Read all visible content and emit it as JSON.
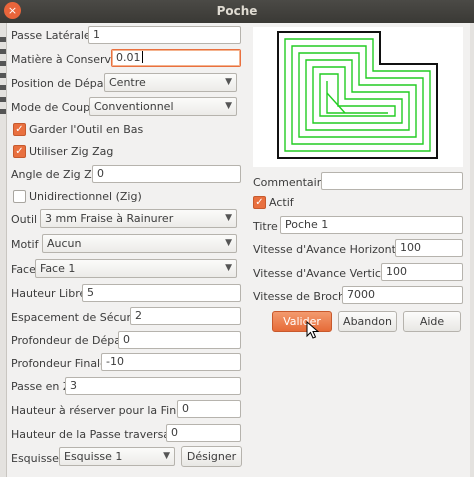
{
  "window": {
    "title": "Poche",
    "close_glyph": "×"
  },
  "form": {
    "passe_laterale": {
      "label": "Passe Latérale",
      "value": "1"
    },
    "matiere_a_conserver": {
      "label": "Matière à Conserver",
      "value": "0.01"
    },
    "position_depart": {
      "label": "Position de Départ",
      "value": "Centre"
    },
    "mode_coupe": {
      "label": "Mode de Coupe",
      "value": "Conventionnel"
    },
    "garder_outil_bas": {
      "label": "Garder l'Outil en Bas",
      "checked": true
    },
    "utiliser_zig_zag": {
      "label": "Utiliser Zig Zag",
      "checked": true
    },
    "angle_zig_zag": {
      "label": "Angle de Zig Zag",
      "value": "0"
    },
    "unidirectionnel": {
      "label": "Unidirectionnel (Zig)",
      "checked": false
    },
    "outil": {
      "label": "Outil",
      "value": "3 mm Fraise à Rainurer"
    },
    "motif": {
      "label": "Motif",
      "value": "Aucun"
    },
    "face": {
      "label": "Face",
      "value": "Face 1"
    },
    "hauteur_libre": {
      "label": "Hauteur Libre",
      "value": "5"
    },
    "espacement_securite": {
      "label": "Espacement de Sécurité",
      "value": "2"
    },
    "profondeur_depart": {
      "label": "Profondeur de Départ",
      "value": "0"
    },
    "profondeur_finale": {
      "label": "Profondeur Finale",
      "value": "-10"
    },
    "passe_en_z": {
      "label": "Passe en Z",
      "value": "3"
    },
    "hauteur_finition": {
      "label": "Hauteur à réserver pour la Finition",
      "value": "0"
    },
    "hauteur_passe_traversante": {
      "label": "Hauteur de la Passe traversante",
      "value": "0"
    },
    "esquisses": {
      "label": "Esquisses",
      "value": "Esquisse 1",
      "button": "Désigner"
    }
  },
  "right": {
    "commentaire": {
      "label": "Commentaire",
      "value": ""
    },
    "actif": {
      "label": "Actif",
      "checked": true
    },
    "titre": {
      "label": "Titre",
      "value": "Poche 1"
    },
    "vitesse_avance_horizontale": {
      "label": "Vitesse d'Avance Horizontale",
      "value": "100"
    },
    "vitesse_avance_verticale": {
      "label": "Vitesse d'Avance Verticale",
      "value": "100"
    },
    "vitesse_broche": {
      "label": "Vitesse de Broche",
      "value": "7000"
    }
  },
  "buttons": {
    "valider": "Valider",
    "abandon": "Abandon",
    "aide": "Aide"
  },
  "glyphs": {
    "dropdown": "▼",
    "check": "✓"
  },
  "colors": {
    "accent": "#e9703f",
    "toolpath": "#22cc22",
    "titlebar": "#3c3b37"
  },
  "icons": [
    "close-icon",
    "dropdown-arrow-icon",
    "check-icon",
    "mouse-cursor-icon"
  ]
}
